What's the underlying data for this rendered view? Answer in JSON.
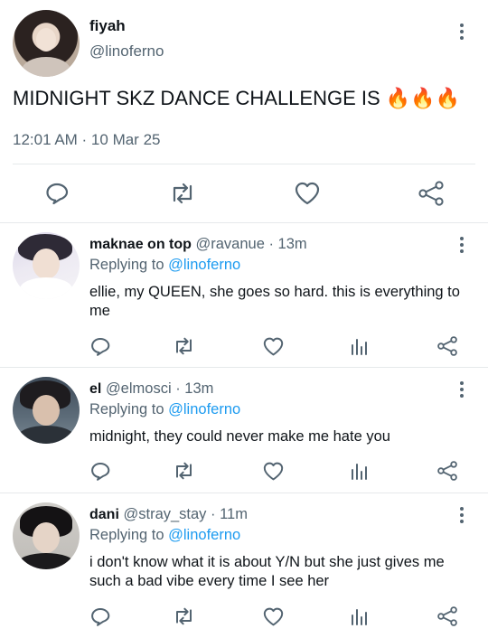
{
  "main_tweet": {
    "display_name": "fiyah",
    "handle": "@linoferno",
    "text": "MIDNIGHT SKZ DANCE CHALLENGE IS ",
    "emojis": "🔥🔥🔥",
    "timestamp": "12:01 AM · 10 Mar 25",
    "avatar_icon": "avatar-photo-icon"
  },
  "replies": [
    {
      "display_name": "maknae on top",
      "handle": "@ravanue",
      "time": " · 13m",
      "replying_prefix": "Replying to ",
      "replying_handle": "@linoferno",
      "text": "ellie, my QUEEN, she goes so hard. this is everything to me"
    },
    {
      "display_name": "el",
      "handle": "@elmosci",
      "time": " · 13m",
      "replying_prefix": "Replying to ",
      "replying_handle": "@linoferno",
      "text": "midnight, they could never make me hate you"
    },
    {
      "display_name": "dani",
      "handle": "@stray_stay",
      "time": " · 11m",
      "replying_prefix": "Replying to ",
      "replying_handle": "@linoferno",
      "text": "i don't know what it is about Y/N but she just gives me such a bad vibe every time I see her"
    }
  ],
  "colors": {
    "link": "#1d9bf0",
    "secondary_text": "#536471",
    "icon": "#536471"
  }
}
